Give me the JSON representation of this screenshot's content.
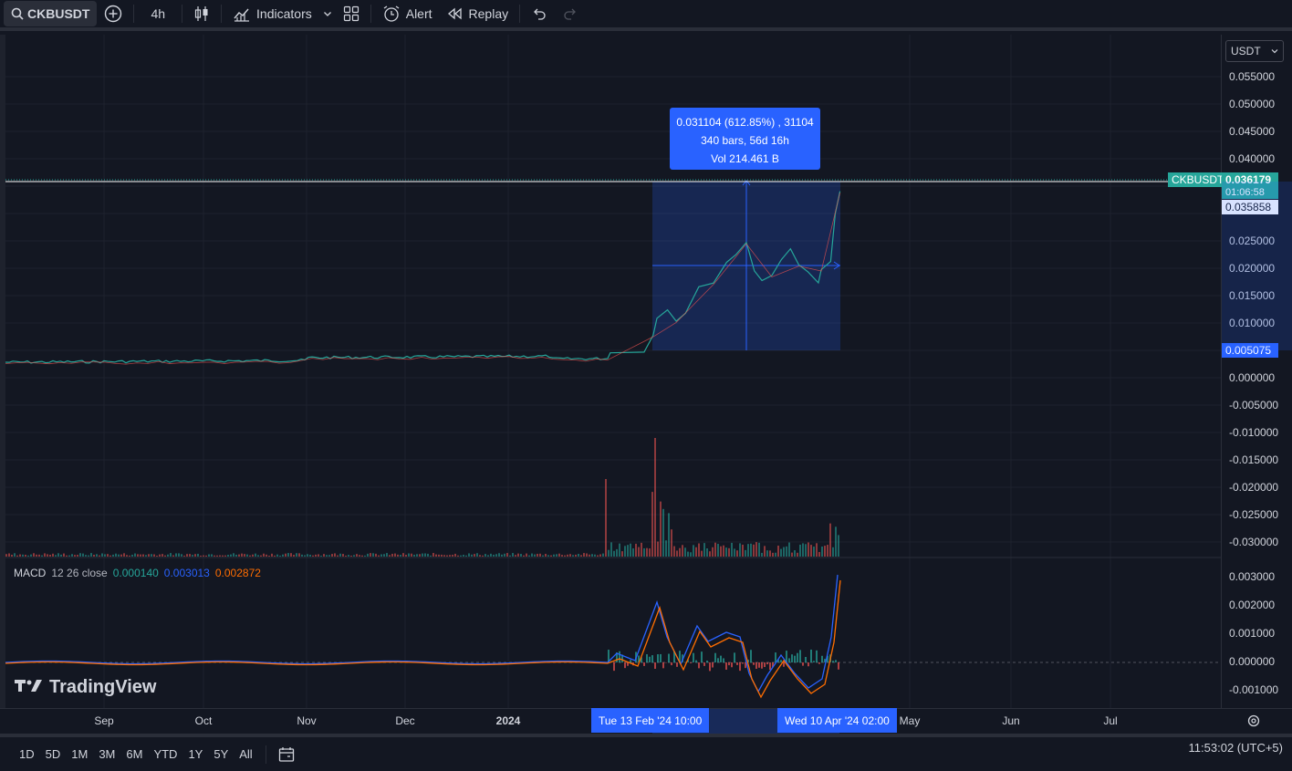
{
  "toolbar": {
    "symbol": "CKBUSDT",
    "interval": "4h",
    "indicators_label": "Indicators",
    "alert_label": "Alert",
    "replay_label": "Replay"
  },
  "price_scale": {
    "currency": "USDT",
    "ticks": [
      "0.055000",
      "0.050000",
      "0.045000",
      "0.040000",
      "0.025000",
      "0.020000",
      "0.015000",
      "0.010000",
      "0.000000",
      "-0.005000",
      "-0.010000",
      "-0.015000",
      "-0.020000",
      "-0.025000",
      "-0.030000"
    ],
    "last_price_symbol": "CKBUSDT",
    "last_price": "0.036179",
    "countdown": "01:06:58",
    "crosshair_price": "0.035858",
    "range_low": "0.005075"
  },
  "macd_scale": {
    "ticks": [
      "0.003000",
      "0.002000",
      "0.001000",
      "0.000000",
      "-0.001000"
    ]
  },
  "time_scale": {
    "ticks": [
      "Sep",
      "Oct",
      "Nov",
      "Dec",
      "2024",
      "May",
      "Jun",
      "Jul"
    ],
    "start_tag": "Tue 13 Feb '24   10:00",
    "end_tag": "Wed 10 Apr '24   02:00"
  },
  "measure": {
    "line1": "0.031104 (612.85%) , 31104",
    "line2": "340 bars, 56d 16h",
    "line3": "Vol 214.461 B"
  },
  "macd_legend": {
    "name": "MACD",
    "params": "12 26 close",
    "value1": "0.000140",
    "value2": "0.003013",
    "value3": "0.002872"
  },
  "brand": "TradingView",
  "bottom": {
    "ranges": [
      "1D",
      "5D",
      "1M",
      "3M",
      "6M",
      "YTD",
      "1Y",
      "5Y",
      "All"
    ],
    "clock": "11:53:02 (UTC+5)"
  },
  "colors": {
    "background": "#131722",
    "accent": "#2962ff",
    "up": "#26a69a",
    "down": "#ef5350",
    "macd_line": "#2962ff",
    "signal_line": "#ff6d00"
  }
}
